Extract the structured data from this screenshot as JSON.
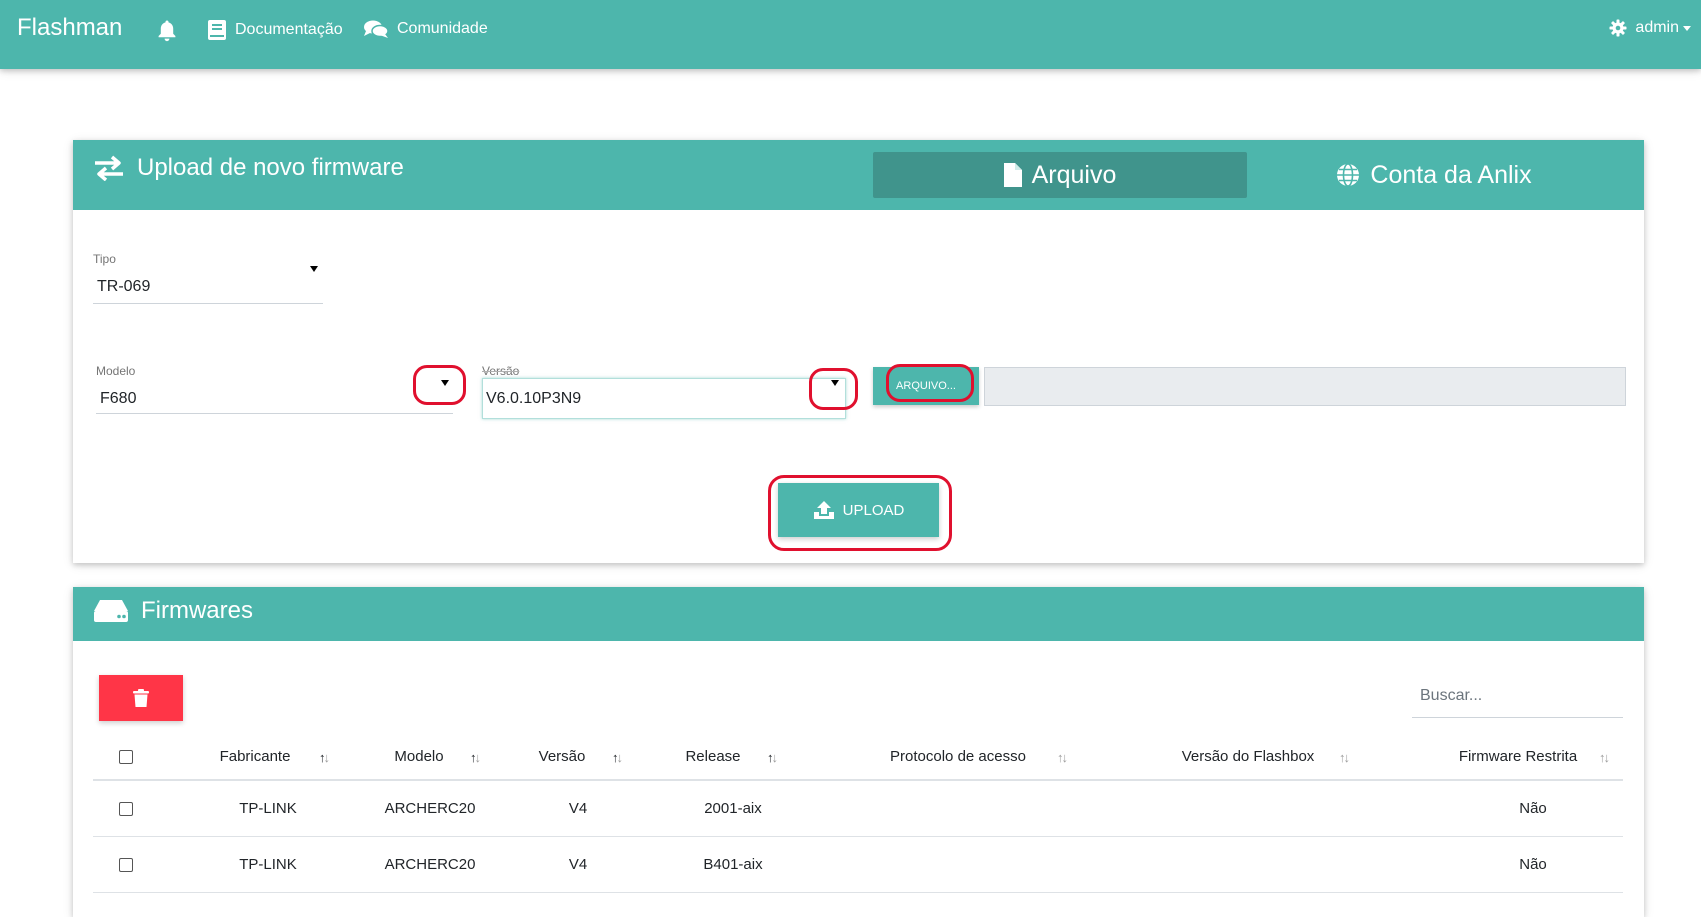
{
  "navbar": {
    "brand": "Flashman",
    "documentacao": "Documentação",
    "comunidade": "Comunidade",
    "admin": "admin"
  },
  "upload_card": {
    "title": "Upload de novo firmware",
    "tab_arquivo": "Arquivo",
    "tab_anlix": "Conta da Anlix",
    "tipo": {
      "label": "Tipo",
      "value": "TR-069"
    },
    "modelo": {
      "label": "Modelo",
      "value": "F680"
    },
    "versao": {
      "label": "Versão",
      "value": "V6.0.10P3N9"
    },
    "arquivo_button": "ARQUIVO...",
    "upload_button": "UPLOAD"
  },
  "firmwares_card": {
    "title": "Firmwares",
    "search_placeholder": "Buscar...",
    "columns": [
      "Fabricante",
      "Modelo",
      "Versão",
      "Release",
      "Protocolo de acesso",
      "Versão do Flashbox",
      "Firmware Restrita"
    ],
    "rows": [
      {
        "fabricante": "TP-LINK",
        "modelo": "ARCHERC20",
        "versao": "V4",
        "release": "2001-aix",
        "protocolo": "",
        "flashbox": "",
        "restrita": "Não"
      },
      {
        "fabricante": "TP-LINK",
        "modelo": "ARCHERC20",
        "versao": "V4",
        "release": "B401-aix",
        "protocolo": "",
        "flashbox": "",
        "restrita": "Não"
      }
    ]
  },
  "colors": {
    "primary": "#4db6ac",
    "tab_active": "#40948c",
    "danger": "#ff3547",
    "highlight_ring": "#e0102e"
  }
}
